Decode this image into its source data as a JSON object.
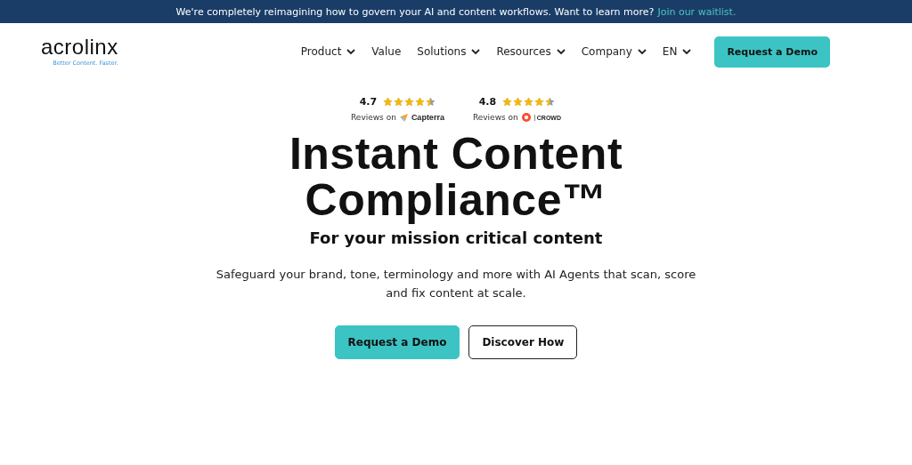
{
  "banner": {
    "text": "We're completely reimagining how to govern your AI and content workflows. Want to learn more?",
    "link": "Join our waitlist."
  },
  "header": {
    "logo": "acrolinx",
    "tagline": "Better Content. Faster.",
    "nav": [
      {
        "label": "Product",
        "dropdown": true
      },
      {
        "label": "Value",
        "dropdown": false
      },
      {
        "label": "Solutions",
        "dropdown": true
      },
      {
        "label": "Resources",
        "dropdown": true
      },
      {
        "label": "Company",
        "dropdown": true
      },
      {
        "label": "EN",
        "dropdown": true
      }
    ],
    "cta": "Request a Demo"
  },
  "ratings": [
    {
      "score": "4.7",
      "stars": 4.5,
      "prefix": "Reviews on",
      "kind": "capterra",
      "brand": "Capterra"
    },
    {
      "score": "4.8",
      "stars": 4.5,
      "prefix": "Reviews on",
      "kind": "g2",
      "brand": "CROWD"
    }
  ],
  "hero": {
    "title": "Instant Content Compliance™",
    "subtitle": "For your mission critical content",
    "description": "Safeguard your brand, tone, terminology and more with AI Agents that scan, score and fix content at scale.",
    "buttons": [
      {
        "label": "Request a Demo",
        "kind": "primary"
      },
      {
        "label": "Discover How",
        "kind": "outline"
      }
    ]
  }
}
